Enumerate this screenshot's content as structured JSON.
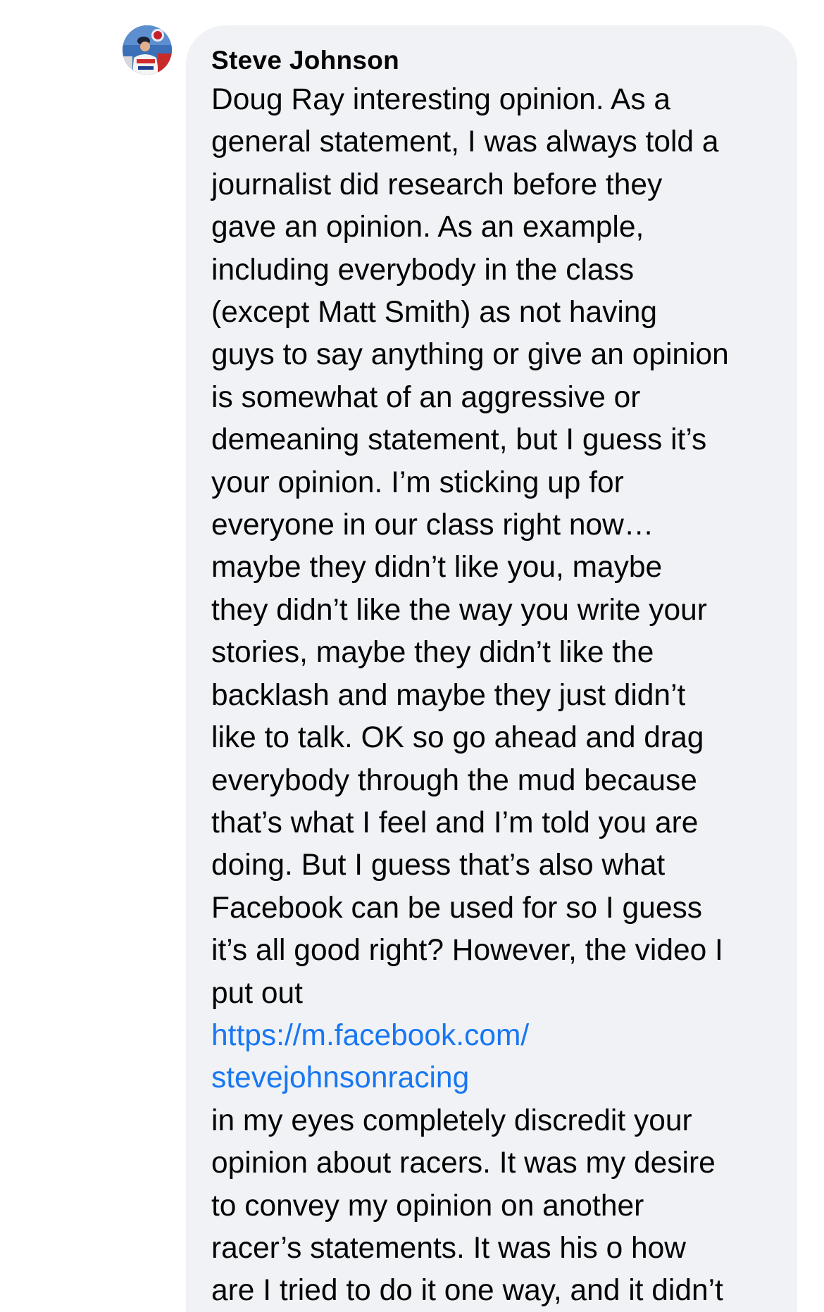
{
  "comment": {
    "author": "Steve Johnson",
    "avatar_icon": "profile-photo-icon",
    "text_lines_before_link": [
      "Doug Ray interesting opinion. As a",
      "general statement, I was always told a",
      "journalist did research before they",
      "gave an opinion. As an example,",
      "including everybody in the class",
      "(except Matt Smith) as not having",
      "guys to say anything or give an opinion",
      "is somewhat of an aggressive or",
      "demeaning statement, but I guess it’s",
      "your opinion. I’m sticking up for",
      "everyone in our class right now…",
      "maybe they didn’t like you, maybe",
      "they didn’t like the way you write your",
      "stories, maybe they didn’t like the",
      "backlash and maybe they just didn’t",
      "like to talk. OK so go ahead and drag",
      "everybody through the mud because",
      "that’s what I feel and I’m told you are",
      "doing. But I guess that’s also what",
      "Facebook can be used for so I guess",
      "it’s all good right? However, the video I",
      "put out"
    ],
    "link_lines": [
      "https://m.facebook.com/",
      "stevejohnsonracing"
    ],
    "text_lines_after_link": [
      "in my eyes completely discredit your",
      "opinion about racers. It was my desire",
      "to convey my opinion on another",
      "racer’s statements. It was his o how",
      "are I tried to do it one way, and it didn’t"
    ]
  },
  "colors": {
    "bubble_background": "#f0f2f5",
    "text": "#050505",
    "link": "#1877f2"
  }
}
